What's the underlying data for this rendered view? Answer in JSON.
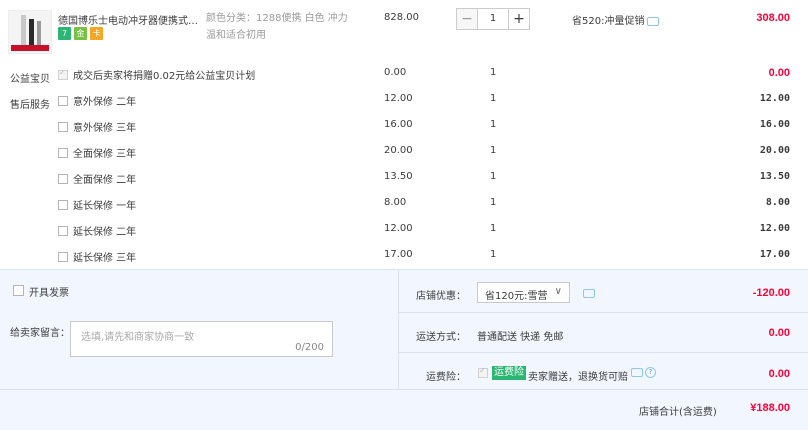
{
  "product": {
    "title": "德国博乐士电动冲牙器便携式水...",
    "thumbnail_caption": "",
    "badges": [
      "7",
      "金",
      "卡"
    ],
    "sku_line1": "颜色分类：1288便携 白色 冲力",
    "sku_line2": "温和适合初用",
    "unit_price": "828.00",
    "quantity": "1",
    "qty_minus": "−",
    "qty_plus": "+",
    "promo": "省520:冲量促销",
    "subtotal": "308.00"
  },
  "charity": {
    "label": "公益宝贝",
    "text": "成交后卖家将捐赠0.02元给公益宝贝计划",
    "price": "0.00",
    "qty": "1",
    "subtotal": "0.00"
  },
  "after_sales": {
    "label": "售后服务",
    "items": [
      {
        "name": "意外保修 二年",
        "price": "12.00",
        "qty": "1",
        "subtotal": "12.00"
      },
      {
        "name": "意外保修 三年",
        "price": "16.00",
        "qty": "1",
        "subtotal": "16.00"
      },
      {
        "name": "全面保修 三年",
        "price": "20.00",
        "qty": "1",
        "subtotal": "20.00"
      },
      {
        "name": "全面保修 二年",
        "price": "13.50",
        "qty": "1",
        "subtotal": "13.50"
      },
      {
        "name": "延长保修 一年",
        "price": "8.00",
        "qty": "1",
        "subtotal": "8.00"
      },
      {
        "name": "延长保修 二年",
        "price": "12.00",
        "qty": "1",
        "subtotal": "12.00"
      },
      {
        "name": "延长保修 三年",
        "price": "17.00",
        "qty": "1",
        "subtotal": "17.00"
      }
    ]
  },
  "invoice": {
    "label": "开具发票"
  },
  "message": {
    "label": "给卖家留言：",
    "placeholder": "选填,请先和商家协商一致",
    "counter": "0/200"
  },
  "store_discount": {
    "label": "店铺优惠：",
    "selected": "省120元:雪营",
    "amount": "-120.00"
  },
  "shipping": {
    "label": "运送方式：",
    "method": "普通配送 快递 免邮",
    "amount": "0.00"
  },
  "insurance": {
    "label": "运费险：",
    "tag": "运费险",
    "text": "卖家赠送，退换货可赔",
    "amount": "0.00"
  },
  "total": {
    "label": "店铺合计(含运费)",
    "amount": "¥188.00"
  },
  "colors": {
    "accent_red": "#ff0036",
    "panel_bg": "#f2f7ff",
    "badge_green": "#2bb673"
  }
}
